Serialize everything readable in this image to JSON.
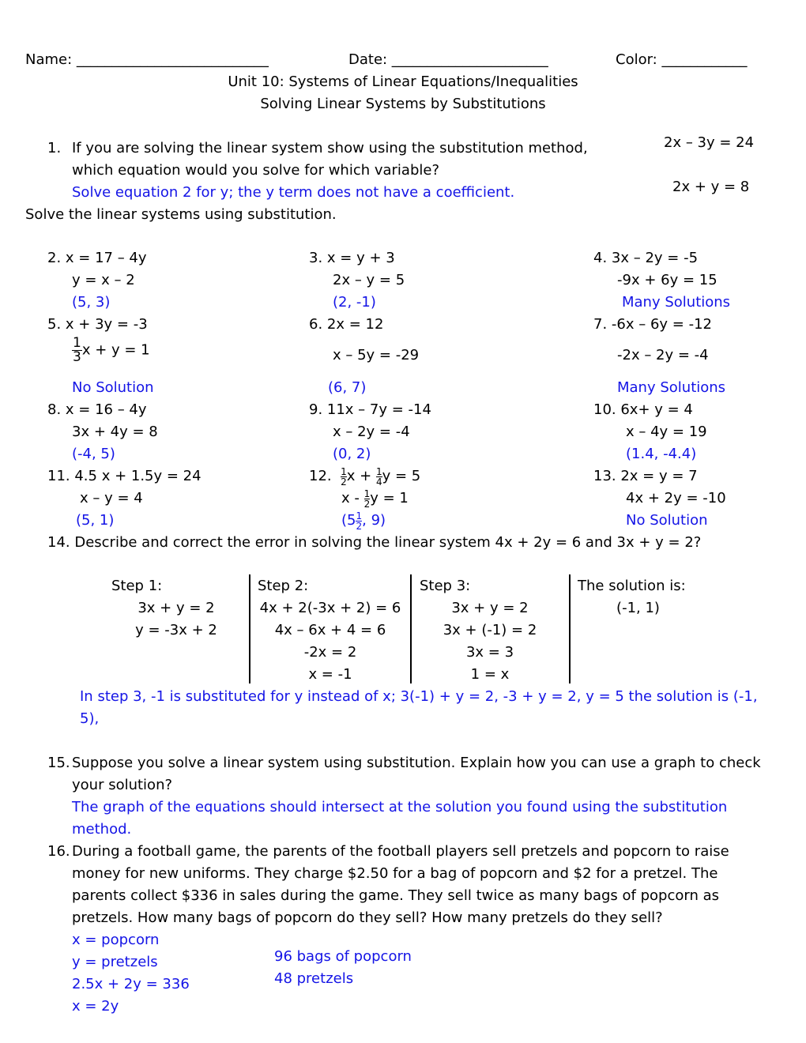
{
  "header": {
    "name_label": "Name: ___________________________",
    "date_label": "Date: ______________________",
    "color_label": "Color: ____________",
    "unit_title": "Unit 10:  Systems of Linear Equations/Inequalities",
    "subtitle": "Solving Linear Systems by Substitutions"
  },
  "q1": {
    "number": "1.",
    "line1": "If you are solving the linear system show using the substitution method,",
    "line2": "which equation would you solve for which variable?",
    "answer": "Solve equation 2 for y; the y term does not have a coefficient.",
    "eq1": "2x – 3y = 24",
    "eq2": "2x + y = 8"
  },
  "instructions": "Solve the linear systems using substitution.",
  "problems": {
    "p2": {
      "label": "2.  x = 17 – 4y",
      "eq2": "y = x – 2",
      "answer": "(5, 3)"
    },
    "p3": {
      "label": "3.  x = y + 3",
      "eq2": "2x – y = 5",
      "answer": "(2, -1)"
    },
    "p4": {
      "label": "4.  3x – 2y = -5",
      "eq2": "-9x + 6y = 15",
      "answer": "Many Solutions"
    },
    "p5": {
      "label": "5.  x + 3y = -3",
      "frac_num": "1",
      "frac_den": "3",
      "eq2_rest": "x + y = 1",
      "answer": "No Solution"
    },
    "p6": {
      "label": "6.  2x = 12",
      "eq2": "x – 5y = -29",
      "answer": "(6, 7)"
    },
    "p7": {
      "label": "7.  -6x – 6y = -12",
      "eq2": "-2x – 2y = -4",
      "answer": "Many Solutions"
    },
    "p8": {
      "label": "8.  x = 16 – 4y",
      "eq2": "3x + 4y = 8",
      "answer": "(-4, 5)"
    },
    "p9": {
      "label": "9.  11x – 7y = -14",
      "eq2": "x – 2y = -4",
      "answer": "(0, 2)"
    },
    "p10": {
      "label": "10.  6x+ y = 4",
      "eq2": "x – 4y = 19",
      "answer": "(1.4, -4.4)"
    },
    "p11": {
      "label": "11.  4.5 x + 1.5y = 24",
      "eq2": "x – y = 4",
      "answer": "(5, 1)"
    },
    "p12": {
      "number": "12.",
      "eq1_a": "x +",
      "eq1_b": "y = 5",
      "eq2_a": "x -",
      "eq2_b": "y = 1",
      "answer_pre": "(5",
      "answer_post": ", 9)",
      "half_n": "1",
      "half_d": "2",
      "quarter_n": "1",
      "quarter_d": "4"
    },
    "p13": {
      "label": "13.  2x = y = 7",
      "eq2": "4x + 2y = -10",
      "answer": "No Solution"
    }
  },
  "q14": {
    "question": "14. Describe and correct the error in solving the linear system 4x + 2y = 6 and 3x + y = 2?",
    "steps": [
      {
        "title": "Step 1:",
        "lines": [
          "3x + y = 2",
          "y = -3x + 2"
        ]
      },
      {
        "title": "Step 2:",
        "lines": [
          "4x + 2(-3x + 2) = 6",
          "4x – 6x + 4 = 6",
          "-2x = 2",
          "x = -1"
        ]
      },
      {
        "title": "Step 3:",
        "lines": [
          "3x + y = 2",
          "3x + (-1) = 2",
          "3x = 3",
          "1 = x"
        ]
      },
      {
        "title": "The solution is:",
        "lines": [
          "(-1, 1)"
        ]
      }
    ],
    "answer_line1": "In step 3, -1 is substituted for y instead of x; 3(-1) + y = 2, -3 + y = 2, y = 5 the solution is (-1,",
    "answer_line2": "5),"
  },
  "q15": {
    "number": "15.",
    "line1": "Suppose you solve a linear system using substitution.  Explain how you can use a graph to check",
    "line2": "your solution?",
    "answer_line1": "The graph of the equations should intersect at the solution you found using the substitution",
    "answer_line2": "method."
  },
  "q16": {
    "number": "16.",
    "lines": [
      "During a football game, the parents of the football players sell pretzels and popcorn to raise",
      "money for new uniforms.  They charge $2.50 for a bag of popcorn and $2 for a pretzel.  The",
      "parents collect $336 in sales during the game.  They sell twice as many bags of popcorn as",
      "pretzels.  How many bags of popcorn do they sell?  How many pretzels do they sell?"
    ],
    "work": [
      "x = popcorn",
      "y = pretzels",
      "2.5x + 2y = 336",
      "x = 2y"
    ],
    "results": [
      "96 bags of popcorn",
      "48 pretzels"
    ]
  }
}
